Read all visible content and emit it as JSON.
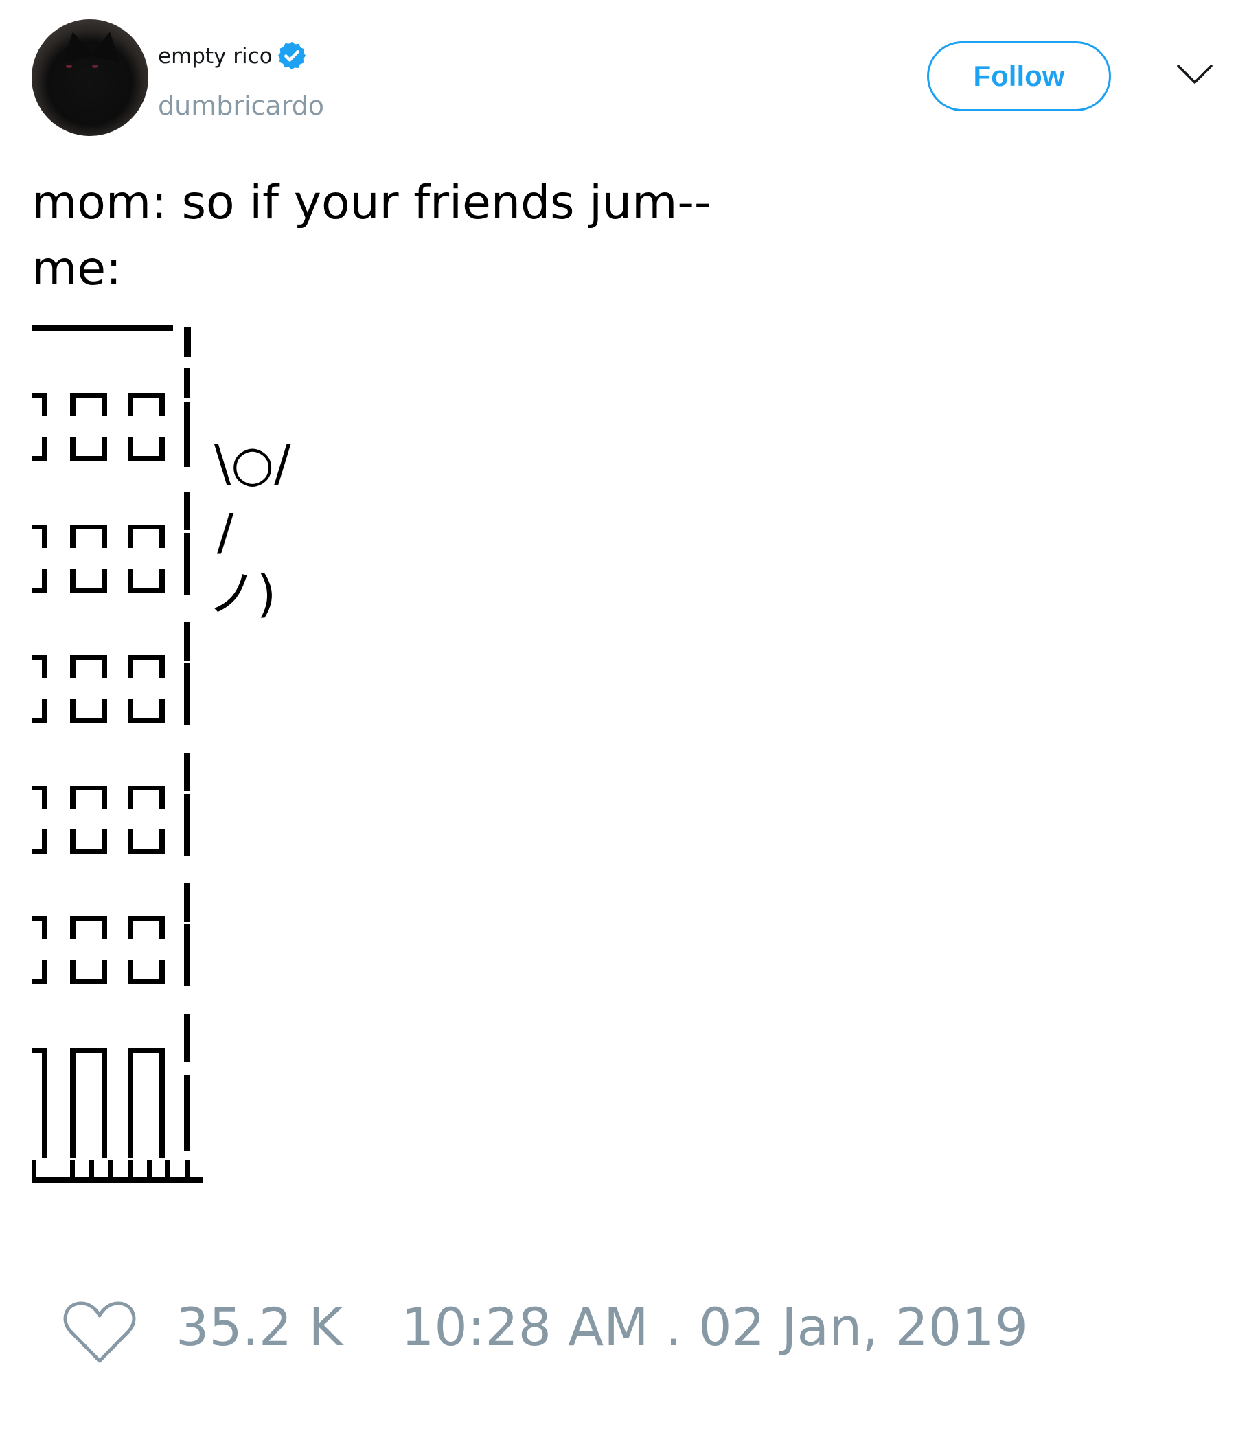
{
  "user": {
    "display_name": "empty rico",
    "handle": "dumbricardo",
    "verified": true,
    "avatar_icon": "black-cat-avatar"
  },
  "header": {
    "follow_label": "Follow",
    "menu_icon": "chevron-down-icon"
  },
  "tweet": {
    "text_line1": "mom: so if your friends jum--",
    "text_line2": "me:",
    "art_glyphs": {
      "arms": "\\○/",
      "body": "/",
      "legs": "ノ)"
    }
  },
  "footer": {
    "like_icon": "heart-icon",
    "likes": "35.2 K",
    "timestamp": "10:28 AM . 02 Jan, 2019"
  },
  "colors": {
    "accent": "#1da1f2",
    "muted": "#8899a6",
    "text": "#14171a"
  }
}
